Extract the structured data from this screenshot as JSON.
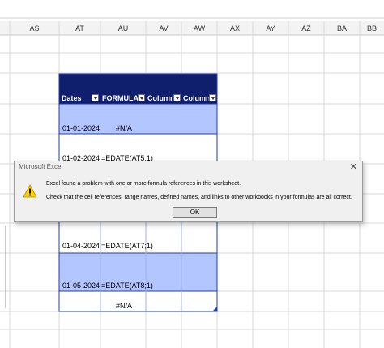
{
  "columns": [
    "AS",
    "AT",
    "AU",
    "AV",
    "AW",
    "AX",
    "AY",
    "AZ",
    "BA",
    "BB"
  ],
  "table": {
    "headers": [
      "Dates",
      "FORMULA",
      "Column",
      "Column"
    ],
    "rows": [
      {
        "date": "01-01-2024",
        "formula": "#N/A"
      },
      {
        "date": "01-02-2024",
        "formula": "=EDATE(AT5;1)"
      },
      {
        "date": "01-04-2024",
        "formula": "=EDATE(AT7;1)"
      },
      {
        "date": "01-05-2024",
        "formula": "=EDATE(AT8;1)"
      },
      {
        "date": "",
        "formula": "#N/A"
      }
    ]
  },
  "dialog": {
    "title": "Microsoft Excel",
    "message1": "Excel found a problem with one or more formula references in this worksheet.",
    "message2": "Check that the cell references, range names, defined names, and links to other workbooks in your formulas are all correct.",
    "ok_label": "OK",
    "close_glyph": "✕"
  },
  "colors": {
    "header_fill": "#0f1f6e",
    "band_fill": "#b4c6ff",
    "border": "#1f3caa"
  }
}
